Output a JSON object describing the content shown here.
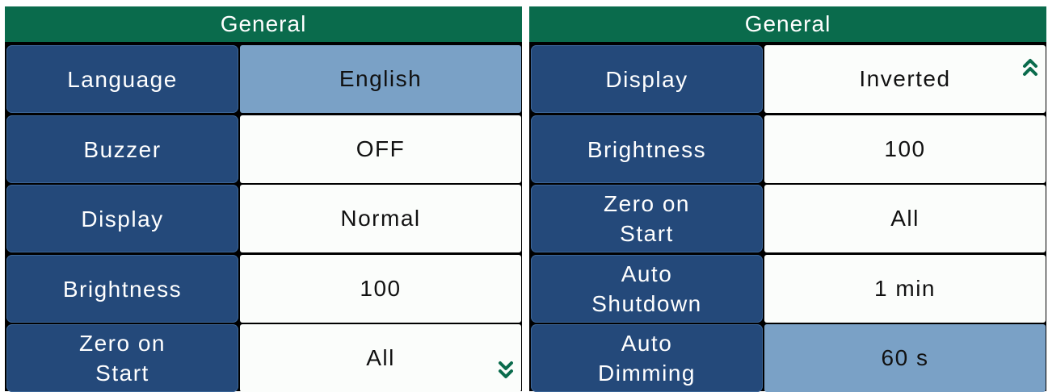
{
  "left_panel": {
    "title": "General",
    "rows": [
      {
        "label": "Language",
        "value": "English",
        "selected": true
      },
      {
        "label": "Buzzer",
        "value": "OFF"
      },
      {
        "label": "Display",
        "value": "Normal"
      },
      {
        "label": "Brightness",
        "value": "100"
      },
      {
        "label": "Zero on\nStart",
        "value": "All"
      }
    ],
    "scroll_icon": "chevron-double-down-icon"
  },
  "right_panel": {
    "title": "General",
    "rows": [
      {
        "label": "Display",
        "value": "Inverted"
      },
      {
        "label": "Brightness",
        "value": "100"
      },
      {
        "label": "Zero on\nStart",
        "value": "All"
      },
      {
        "label": "Auto\nShutdown",
        "value": "1 min"
      },
      {
        "label": "Auto\nDimming",
        "value": "60 s",
        "selected": true
      }
    ],
    "scroll_icon": "chevron-double-up-icon"
  },
  "colors": {
    "header": "#0a6b4c",
    "label_bg": "#24497a",
    "value_bg": "#fbfdfb",
    "selected_bg": "#7aa1c6"
  }
}
